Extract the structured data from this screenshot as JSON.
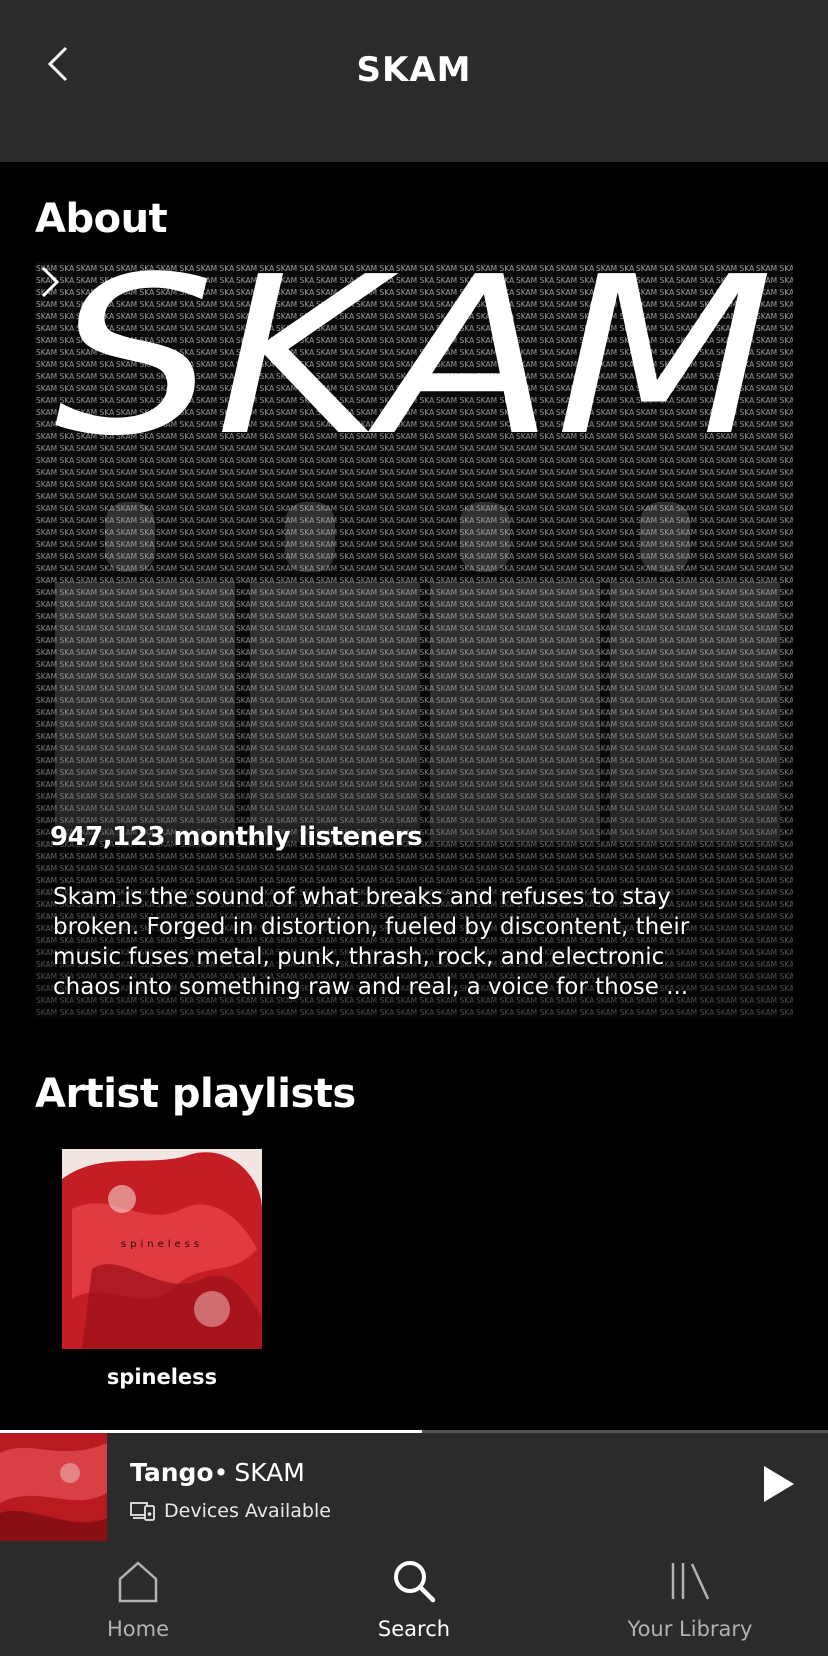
{
  "header": {
    "title": "SKAM",
    "back_icon": "chevron-left-icon"
  },
  "about": {
    "section_title": "About",
    "logo_text": "SKAM",
    "texture_word": "SKAM",
    "monthly_listeners": "947,123 monthly listeners",
    "bio": "Skam is the sound of what breaks and refuses to stay broken. Forged in distortion, fueled by discontent, their music fuses metal, punk, thrash, rock, and electronic chaos into something raw and real, a voice for those ...",
    "expand_icon": "chevron-right-icon"
  },
  "artist_playlists": {
    "section_title": "Artist playlists",
    "items": [
      {
        "name": "spineless",
        "cover_text": "spineless"
      }
    ]
  },
  "now_playing": {
    "track": "Tango",
    "separator": "•",
    "artist": "SKAM",
    "devices_label": "Devices Available",
    "devices_icon": "devices-icon",
    "play_icon": "play-icon",
    "progress": 0.51
  },
  "tabbar": {
    "tabs": [
      {
        "label": "Home",
        "icon": "home-icon",
        "active": false
      },
      {
        "label": "Search",
        "icon": "search-icon",
        "active": true
      },
      {
        "label": "Your Library",
        "icon": "library-icon",
        "active": false
      }
    ]
  },
  "colors": {
    "background": "#000000",
    "bar": "#2b2b2b",
    "accent_red": "#c41e24",
    "text": "#ffffff",
    "inactive": "#b3b3b3"
  }
}
